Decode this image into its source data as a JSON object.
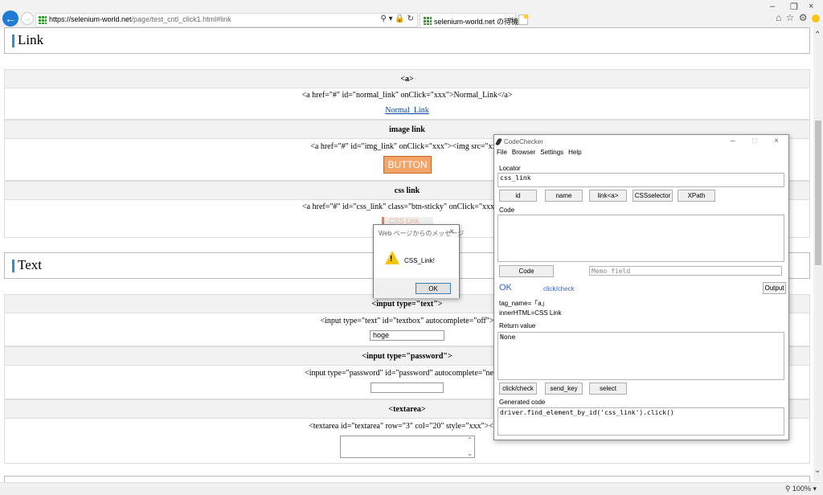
{
  "browser": {
    "url_host": "https://selenium-world.net",
    "url_path": "/page/test_cntl_click1.html#link",
    "tab_title": "selenium-world.net の待機中",
    "zoom": "100%"
  },
  "page": {
    "link_section": {
      "title": "Link",
      "rows": [
        {
          "header": "<a>",
          "code": "<a href=\"#\" id=\"normal_link\" onClick=\"xxx\">Normal_Link</a>",
          "link_text": "Normal_Link"
        },
        {
          "header": "image link",
          "code": "<a href=\"#\" id=\"img_link\" onClick=\"xxx\"><img src=\"xxx\"",
          "button_text": "BUTTON"
        },
        {
          "header": "css link",
          "code": "<a href=\"#\" id=\"css_link\" class=\"btn-sticky\" onClick=\"xxx\">CS",
          "button_text": "CSS Link"
        }
      ]
    },
    "text_section": {
      "title": "Text",
      "rows": [
        {
          "header": "<input type=\"text\">",
          "code": "<input type=\"text\" id=\"textbox\" autocomplete=\"off\">",
          "value": "hoge"
        },
        {
          "header": "<input type=\"password\">",
          "code": "<input type=\"password\" id=\"password\" autocomplete=\"new-pa",
          "value": ""
        },
        {
          "header": "<textarea>",
          "code": "<textarea id=\"textarea\" row=\"3\" col=\"20\" style=\"xxx\"></tex",
          "value": ""
        }
      ]
    }
  },
  "alert": {
    "title": "Web ページからのメッセージ",
    "message": "CSS_Link!",
    "ok_label": "OK"
  },
  "codechecker": {
    "title": "CodeChecker",
    "menu": [
      "File",
      "Browser",
      "Settings",
      "Help"
    ],
    "locator_label": "Locator",
    "locator_value": "css_link",
    "locator_buttons": [
      "id",
      "name",
      "link<a>",
      "CSSselector",
      "XPath"
    ],
    "code_label": "Code",
    "code_value": "",
    "code_button": "Code",
    "memo_placeholder": "Memo field",
    "status_ok": "OK",
    "status_action": "click/check",
    "output_button": "Output",
    "tag_name": "tag_name=「a」",
    "inner_html": "innerHTML=CSS Link",
    "return_label": "Return value",
    "return_value": "None",
    "action_buttons": [
      "click/check",
      "send_key",
      "select"
    ],
    "generated_label": "Generated code",
    "generated_value": "driver.find_element_by_id('css_link').click()"
  }
}
